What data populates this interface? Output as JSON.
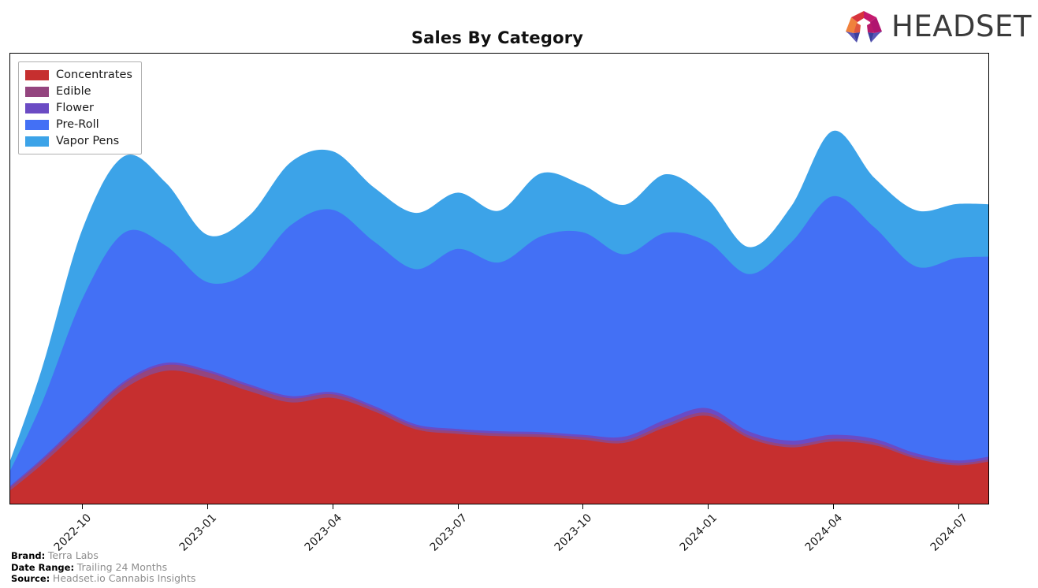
{
  "header": {
    "title": "Sales By Category",
    "logo_word": "HEADSET",
    "logo_icon": "headset-arch-logo"
  },
  "footer": {
    "rows": [
      {
        "key": "Brand:",
        "value": "Terra Labs"
      },
      {
        "key": "Date Range:",
        "value": "Trailing 24 Months"
      },
      {
        "key": "Source:",
        "value": "Headset.io Cannabis Insights"
      }
    ]
  },
  "legend": {
    "position": "top-left",
    "items": [
      {
        "label": "Concentrates",
        "color": "#c62f2f"
      },
      {
        "label": "Edible",
        "color": "#94457f"
      },
      {
        "label": "Flower",
        "color": "#6b4bc4"
      },
      {
        "label": "Pre-Roll",
        "color": "#4370f5"
      },
      {
        "label": "Vapor Pens",
        "color": "#3ca3e8"
      }
    ]
  },
  "chart_data": {
    "type": "area",
    "stacked": true,
    "smoothing": "spline",
    "title": "Sales By Category",
    "xlabel": "",
    "ylabel": "",
    "grid": false,
    "legend_position": "upper left",
    "x": [
      "2022-08",
      "2022-09",
      "2022-10",
      "2022-11",
      "2022-12",
      "2023-01",
      "2023-02",
      "2023-03",
      "2023-04",
      "2023-05",
      "2023-06",
      "2023-07",
      "2023-08",
      "2023-09",
      "2023-10",
      "2023-11",
      "2023-12",
      "2024-01",
      "2024-02",
      "2024-03",
      "2024-04",
      "2024-05",
      "2024-06",
      "2024-07",
      "2024-08"
    ],
    "tick_labels": [
      "2022-10",
      "2023-01",
      "2023-04",
      "2023-07",
      "2023-10",
      "2024-01",
      "2024-04",
      "2024-07"
    ],
    "tick_x": [
      "2022-10",
      "2023-01",
      "2023-04",
      "2023-07",
      "2023-10",
      "2024-01",
      "2024-04",
      "2024-07"
    ],
    "ylim": [
      0,
      100
    ],
    "series": [
      {
        "name": "Concentrates",
        "color": "#c62f2f",
        "values": [
          1.0,
          8.5,
          17.0,
          25.5,
          29.5,
          28.0,
          25.0,
          22.5,
          23.5,
          20.5,
          16.5,
          15.5,
          15.0,
          14.8,
          14.2,
          13.5,
          17.0,
          19.5,
          14.5,
          12.5,
          13.8,
          13.0,
          10.0,
          8.5,
          9.8
        ]
      },
      {
        "name": "Edible",
        "color": "#94457f",
        "values": [
          0.6,
          0.9,
          1.1,
          1.2,
          1.3,
          1.2,
          1.0,
          0.9,
          0.8,
          0.7,
          0.6,
          0.6,
          0.6,
          0.6,
          0.6,
          0.6,
          0.7,
          0.7,
          0.6,
          0.6,
          0.6,
          0.6,
          0.5,
          0.5,
          0.5
        ]
      },
      {
        "name": "Flower",
        "color": "#6b4bc4",
        "values": [
          0.3,
          0.4,
          0.5,
          0.5,
          0.5,
          0.5,
          0.5,
          0.5,
          0.5,
          0.5,
          0.5,
          0.5,
          0.5,
          0.5,
          0.5,
          0.8,
          1.0,
          1.0,
          0.9,
          0.9,
          0.9,
          0.8,
          0.7,
          0.6,
          0.6
        ]
      },
      {
        "name": "Pre-Roll",
        "color": "#4370f5",
        "values": [
          0.5,
          12.0,
          27.0,
          33.0,
          26.0,
          19.5,
          25.0,
          38.0,
          40.5,
          36.5,
          34.5,
          40.0,
          37.5,
          43.5,
          45.0,
          40.5,
          41.5,
          37.0,
          35.0,
          44.0,
          53.0,
          47.0,
          41.5,
          45.0,
          44.0
        ]
      },
      {
        "name": "Vapor Pens",
        "color": "#3ca3e8",
        "values": [
          0.4,
          7.5,
          15.5,
          17.0,
          14.0,
          10.5,
          12.5,
          14.0,
          13.0,
          12.0,
          12.5,
          12.5,
          11.5,
          14.0,
          10.5,
          11.0,
          13.0,
          9.5,
          6.0,
          8.0,
          14.5,
          11.0,
          12.5,
          12.0,
          11.5
        ]
      }
    ]
  },
  "axis": {
    "x_tick_count": 8,
    "y_visible": false
  }
}
